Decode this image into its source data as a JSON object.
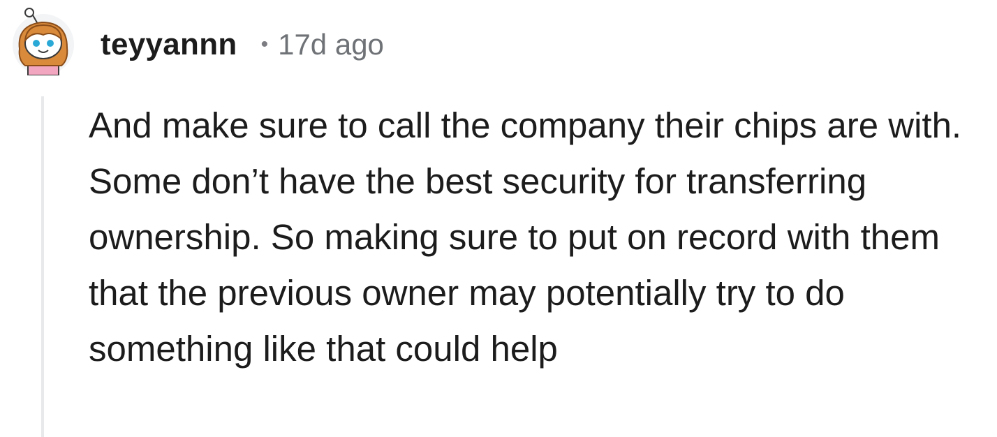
{
  "comment": {
    "avatar_icon": "snoo-avatar-icon",
    "username": "teyyannn",
    "separator": "•",
    "timestamp": "17d ago",
    "body": "And make sure to call the company their chips are with. Some don’t have the best security for transferring ownership. So making sure to put on record with them that the previous owner may potentially try to do something like that could help"
  },
  "colors": {
    "text": "#1c1c1c",
    "meta": "#6f7276",
    "thread_line": "#e7e9eb",
    "avatar_hair": "#d98a3a",
    "avatar_eyes": "#2aa9d6",
    "avatar_shirt": "#f3a6c0"
  }
}
